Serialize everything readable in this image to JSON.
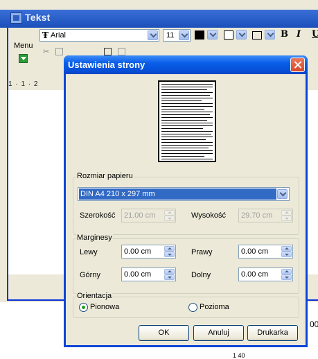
{
  "app": {
    "title": "Tekst",
    "menu_label": "Menu",
    "font_name": "Arial",
    "font_size": "11",
    "ruler_text": "1 · 1 · 2",
    "stray_text": "00",
    "stray_text2": "1 40"
  },
  "dialog": {
    "title": "Ustawienia strony",
    "paper_group": {
      "legend": "Rozmiar papieru",
      "selected_size": "DIN A4 210 x 297 mm",
      "width_label": "Szerokość",
      "width_value": "21.00 cm",
      "height_label": "Wysokość",
      "height_value": "29.70 cm"
    },
    "margins_group": {
      "legend": "Marginesy",
      "left_label": "Lewy",
      "left_value": "0.00 cm",
      "right_label": "Prawy",
      "right_value": "0.00 cm",
      "top_label": "Górny",
      "top_value": "0.00 cm",
      "bottom_label": "Dolny",
      "bottom_value": "0.00 cm"
    },
    "orientation_group": {
      "legend": "Orientacja",
      "portrait_label": "Pionowa",
      "landscape_label": "Pozioma",
      "selected": "Pionowa"
    },
    "buttons": {
      "ok": "OK",
      "cancel": "Anuluj",
      "print": "Drukarka"
    }
  },
  "colors": {
    "titlebar": "#0a5ee8",
    "selection": "#316ac5",
    "close": "#d8492a",
    "radio_dot": "#21a121"
  }
}
